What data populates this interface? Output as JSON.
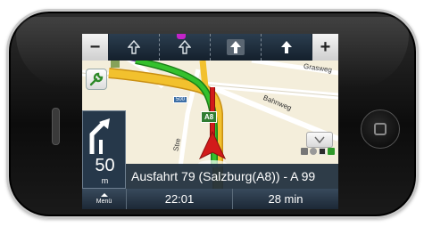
{
  "lane_bar": {
    "zoom_out_label": "−",
    "zoom_in_label": "+",
    "lanes": [
      "arrow-up",
      "arrow-up",
      "arrow-up-highlight",
      "arrow-up"
    ]
  },
  "map": {
    "streets": [
      "Grasweg",
      "Bahnweg",
      "Stre"
    ],
    "road_shield": "A8",
    "distance_sign": "500"
  },
  "maneuver": {
    "icon": "turn-right-icon",
    "distance_value": "50",
    "distance_unit": "m"
  },
  "next_road": "Ausfahrt 79 (Salzburg(A8)) - A 99",
  "bottom_bar": {
    "menu_label": "Menü",
    "arrival_time": "22:01",
    "remaining_time": "28 min"
  },
  "colors": {
    "route": "#34c12d",
    "position_arrow": "#d21a1a",
    "panel": "#26384a",
    "map_background": "#f4eedb",
    "highway": "#f2c12e"
  }
}
